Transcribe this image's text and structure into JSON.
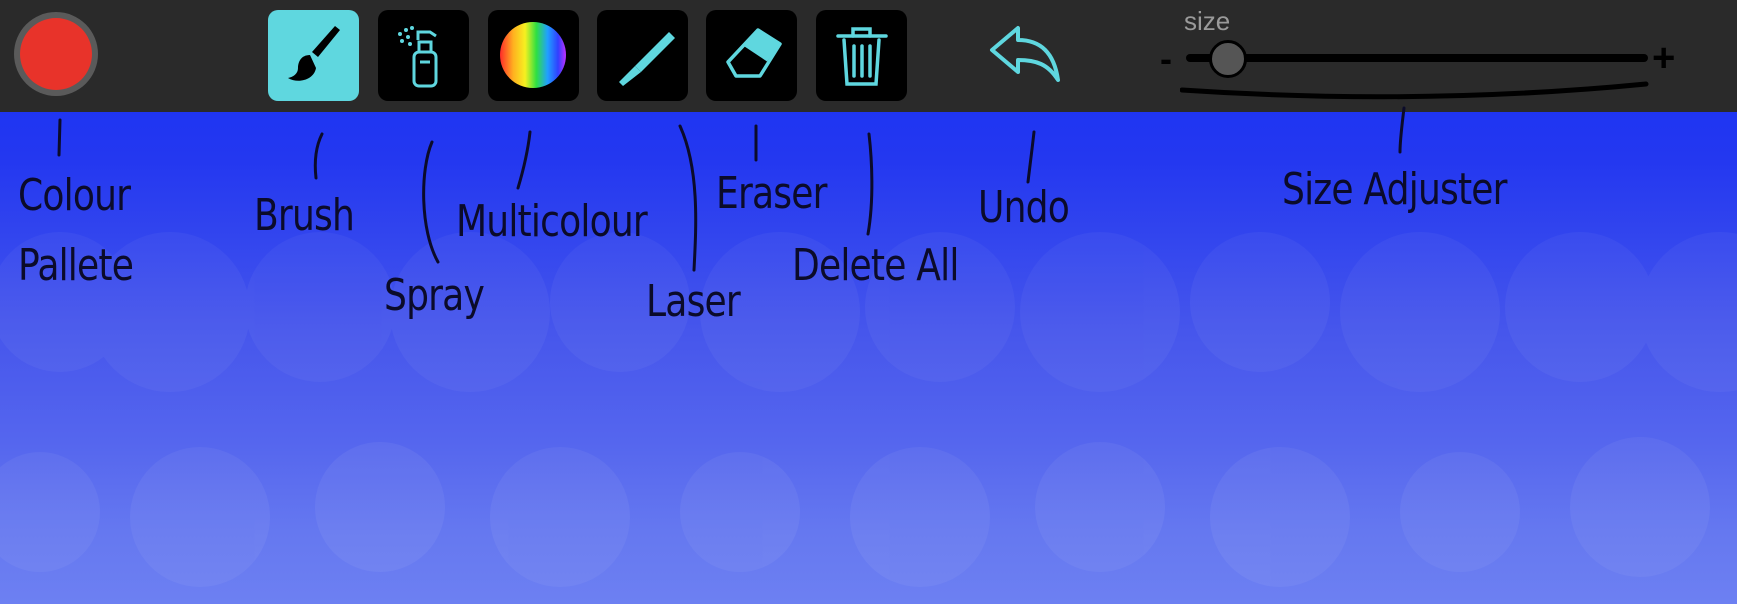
{
  "toolbar": {
    "current_color": "#e8332a",
    "tools": [
      {
        "name": "brush-button",
        "icon": "brush-icon",
        "active": true
      },
      {
        "name": "spray-button",
        "icon": "spray-can-icon",
        "active": false
      },
      {
        "name": "multicolour-button",
        "icon": "rainbow-circle-icon",
        "active": false
      },
      {
        "name": "laser-button",
        "icon": "laser-pen-icon",
        "active": false
      },
      {
        "name": "eraser-button",
        "icon": "eraser-icon",
        "active": false
      },
      {
        "name": "delete-all-button",
        "icon": "trash-icon",
        "active": false
      }
    ],
    "undo_icon": "undo-arrow-icon",
    "accent_color": "#5fd7df",
    "size": {
      "label": "size",
      "minus": "-",
      "plus": "+",
      "value_fraction": 0.07
    }
  },
  "annotations": {
    "colour": "Colour",
    "pallete": "Pallete",
    "brush": "Brush",
    "spray": "Spray",
    "multicolour": "Multicolour",
    "laser": "Laser",
    "eraser": "Eraser",
    "delete_all": "Delete All",
    "undo": "Undo",
    "size_adjuster": "Size Adjuster"
  }
}
